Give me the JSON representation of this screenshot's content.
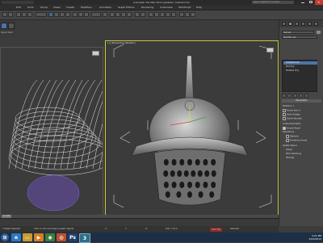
{
  "app": {
    "title": "Autodesk 3ds Max 2013   gladiator_helmet.max",
    "search_placeholder": "Type a keyword or phrase",
    "menu": [
      "Edit",
      "Tools",
      "Group",
      "Views",
      "Create",
      "Modifiers",
      "Animation",
      "Graph Editors",
      "Rendering",
      "Customize",
      "MAXScript",
      "Help"
    ]
  },
  "viewports": {
    "left_label": "[+] [Perspective] [Realistic]",
    "center_label": "[+] [Perspective] [Realistic]"
  },
  "left_strip": {
    "label": "Object Paint"
  },
  "command_panel": {
    "object_name": "Helmet",
    "modifier_list": "Modifier List",
    "stack": [
      "TurboSmooth",
      "Edit Poly",
      "Editable Poly"
    ],
    "rollout": "Parameters",
    "params": [
      "Iterations: 1",
      "Render Iters: 0",
      "Isoline Display",
      "Explicit Normals",
      "Surface Parameters",
      "Smooth Result",
      "Separate by:",
      "Materials",
      "Smoothing Groups",
      "Update Options",
      "Always",
      "When Rendering",
      "Manually"
    ]
  },
  "status": {
    "frame": "0 / 100",
    "selection": "1 Object Selected",
    "prompt": "Click or click-and-drag to select objects",
    "x": "X:",
    "y": "Y:",
    "z": "Z:",
    "grid": "Grid = 10.0",
    "autokey": "Auto Key",
    "selected": "Selected"
  },
  "taskbar": {
    "time": "4:21 PM",
    "date": "5/23/2013",
    "apps": [
      "ie-icon",
      "folder-icon",
      "media-player-icon",
      "chrome-icon",
      "firefox-icon",
      "photoshop-icon",
      "3dsmax-icon"
    ]
  },
  "colors": {
    "viewport_bg": "#3b3b3b",
    "active_border": "#c8c832",
    "selection_blue": "#4c74a8",
    "wireframe": "#e6e6e6",
    "wireframe_selected": "#8a6ad0",
    "taskbar": "#1d2f45"
  }
}
